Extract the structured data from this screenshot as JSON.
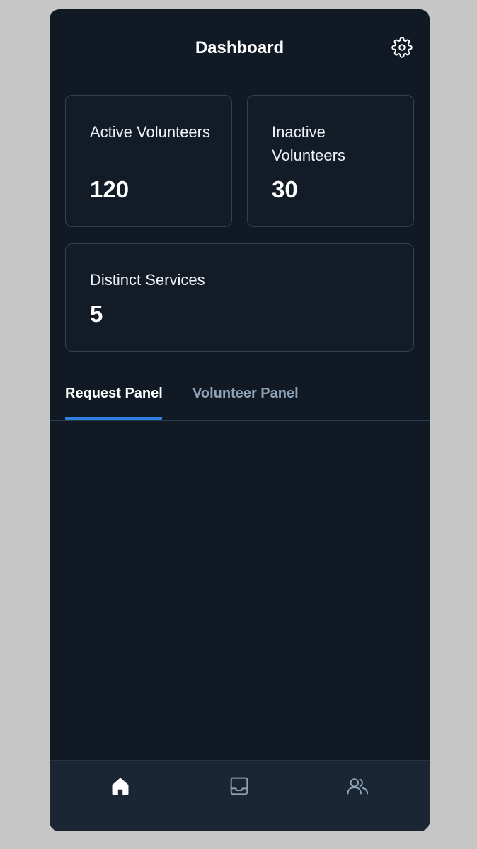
{
  "header": {
    "title": "Dashboard",
    "settings_icon": "gear-icon"
  },
  "stats": {
    "active": {
      "label": "Active Volunteers",
      "value": "120"
    },
    "inactive": {
      "label": "Inactive Volunteers",
      "value": "30"
    },
    "services": {
      "label": "Distinct Services",
      "value": "5"
    }
  },
  "tabs": [
    {
      "label": "Request Panel",
      "active": true
    },
    {
      "label": "Volunteer Panel",
      "active": false
    }
  ],
  "bottom_nav": [
    {
      "icon": "home-icon",
      "active": true
    },
    {
      "icon": "inbox-icon",
      "active": false
    },
    {
      "icon": "users-icon",
      "active": false
    }
  ],
  "colors": {
    "background": "#111a24",
    "accent": "#2f80e0",
    "card_border": "#324152",
    "inactive_tab": "#8ea2b8"
  }
}
